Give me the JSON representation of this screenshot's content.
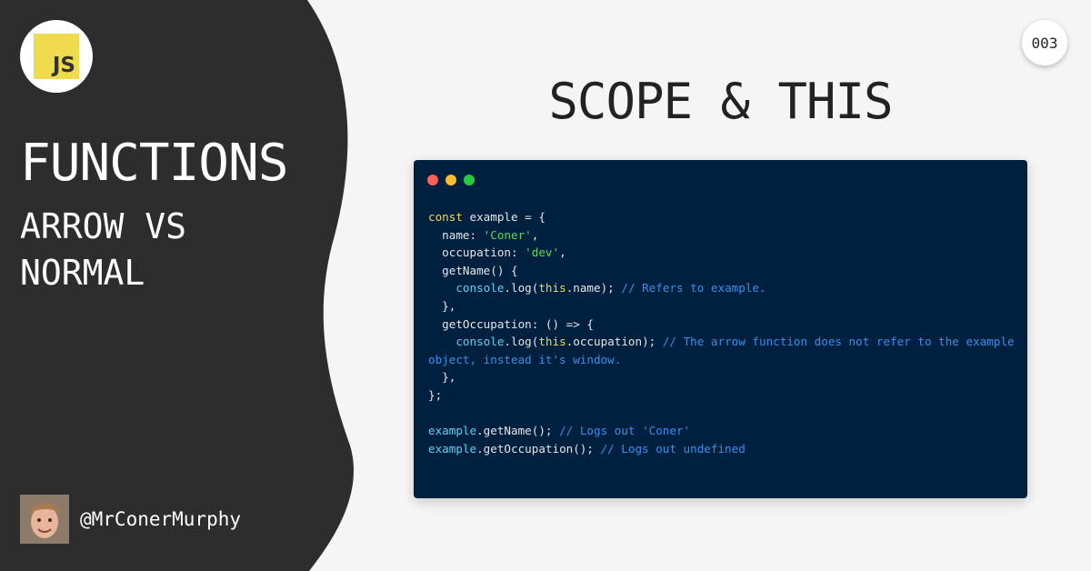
{
  "logo": {
    "text": "JS"
  },
  "topic": {
    "title": "FUNCTIONS",
    "subtitle": "ARROW VS NORMAL"
  },
  "author": {
    "handle": "@MrConerMurphy"
  },
  "badge": {
    "number": "003"
  },
  "main": {
    "title": "SCOPE & THIS"
  },
  "code": {
    "line1_kw": "const",
    "line1_rest": " example = {",
    "line2_key": "  name: ",
    "line2_str": "'Coner'",
    "line2_end": ",",
    "line3_key": "  occupation: ",
    "line3_str": "'dev'",
    "line3_end": ",",
    "line4": "  getName() {",
    "line5_pre": "    console",
    "line5_mid": ".log(",
    "line5_this": "this",
    "line5_post": ".name); ",
    "line5_comment": "// Refers to example.",
    "line6": "  },",
    "line7": "  getOccupation: () => {",
    "line8_pre": "    console",
    "line8_mid": ".log(",
    "line8_this": "this",
    "line8_post": ".occupation); ",
    "line8_comment": "// The arrow function does not refer to the example object, instead it's window.",
    "line9": "  },",
    "line10": "};",
    "line12_obj": "example",
    "line12_call": ".getName(); ",
    "line12_comment": "// Logs out 'Coner'",
    "line13_obj": "example",
    "line13_call": ".getOccupation(); ",
    "line13_comment": "// Logs out undefined"
  },
  "colors": {
    "left_panel": "#2d2d2d",
    "background": "#f5f5f5",
    "code_bg": "#00203f",
    "js_yellow": "#f0db4f",
    "string_green": "#5fd75f",
    "comment_blue": "#3b8eea"
  }
}
